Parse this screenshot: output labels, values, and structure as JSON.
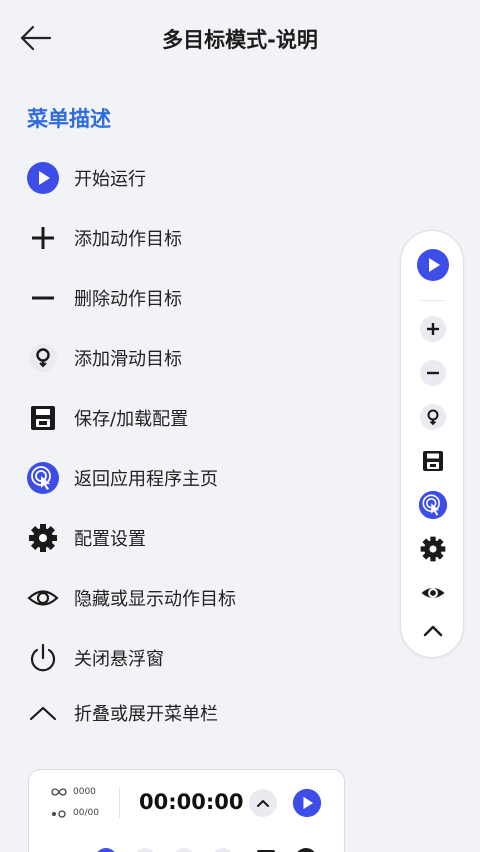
{
  "header": {
    "title": "多目标模式-说明"
  },
  "section": {
    "title": "菜单描述"
  },
  "menu": [
    {
      "label": "开始运行",
      "icon": "play-circle-icon"
    },
    {
      "label": "添加动作目标",
      "icon": "plus-icon"
    },
    {
      "label": "删除动作目标",
      "icon": "minus-icon"
    },
    {
      "label": "添加滑动目标",
      "icon": "swipe-target-icon"
    },
    {
      "label": "保存/加载配置",
      "icon": "save-icon"
    },
    {
      "label": "返回应用程序主页",
      "icon": "home-tap-icon"
    },
    {
      "label": "配置设置",
      "icon": "gear-icon"
    },
    {
      "label": "隐藏或显示动作目标",
      "icon": "eye-icon"
    },
    {
      "label": "关闭悬浮窗",
      "icon": "power-icon"
    },
    {
      "label": "折叠或展开菜单栏",
      "icon": "chevron-up-icon"
    }
  ],
  "preview": {
    "loop_count": "0000",
    "progress": "00/00",
    "timer": "00:00:00"
  },
  "colors": {
    "accent": "#3d4ee8",
    "section": "#2f6ce0",
    "background": "#f1f3f6"
  }
}
